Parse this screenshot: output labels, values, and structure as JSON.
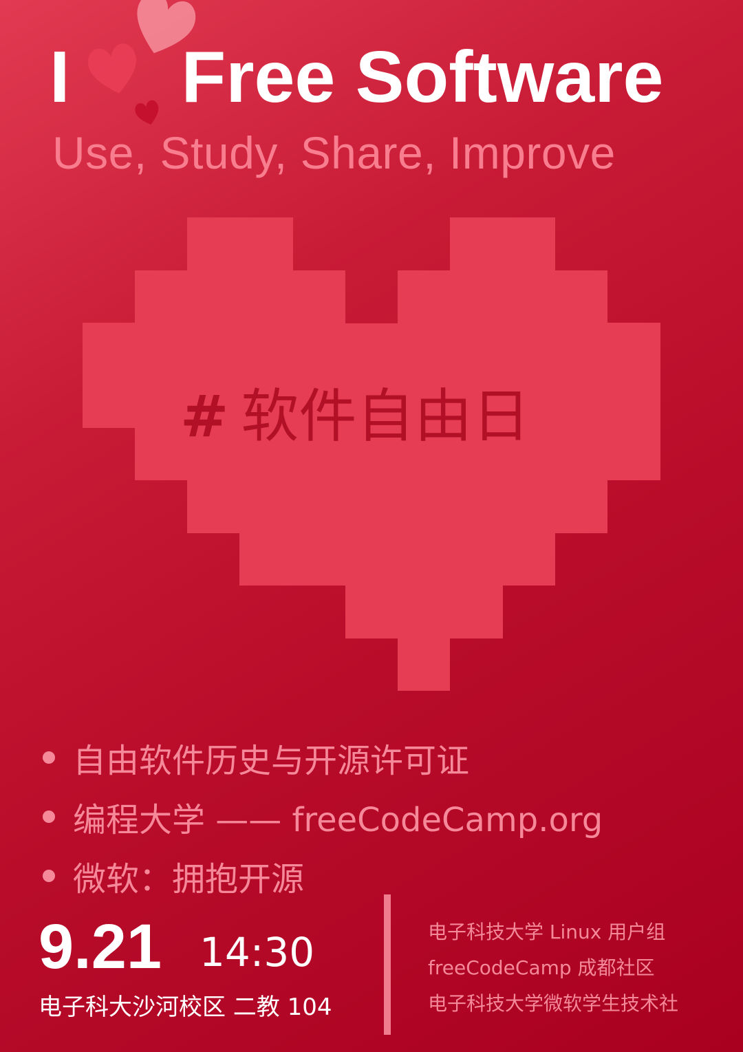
{
  "headline": {
    "left": "I",
    "right": "Free Software"
  },
  "subtitle": "Use, Study, Share, Improve",
  "hashtag": {
    "symbol": "#",
    "text": "软件自由日"
  },
  "topics": [
    "自由软件历史与开源许可证",
    "编程大学 —— freeCodeCamp.org",
    "微软：拥抱开源"
  ],
  "event": {
    "date": "9.21",
    "time": "14:30",
    "venue": "电子科大沙河校区 二教 104"
  },
  "organizers": [
    "电子科技大学 Linux 用户组",
    "freeCodeCamp 成都社区",
    "电子科技大学微软学生技术社"
  ],
  "icons": {
    "hearts": "hearts-icon",
    "pixel_heart": "pixel-heart-icon",
    "bullet": "bullet-icon"
  },
  "colors": {
    "background": "#c0142f",
    "pixel_heart": "#e63d55",
    "hashtag": "#b21027",
    "pink_text": "#f5899a",
    "white_text": "#ffffff"
  }
}
